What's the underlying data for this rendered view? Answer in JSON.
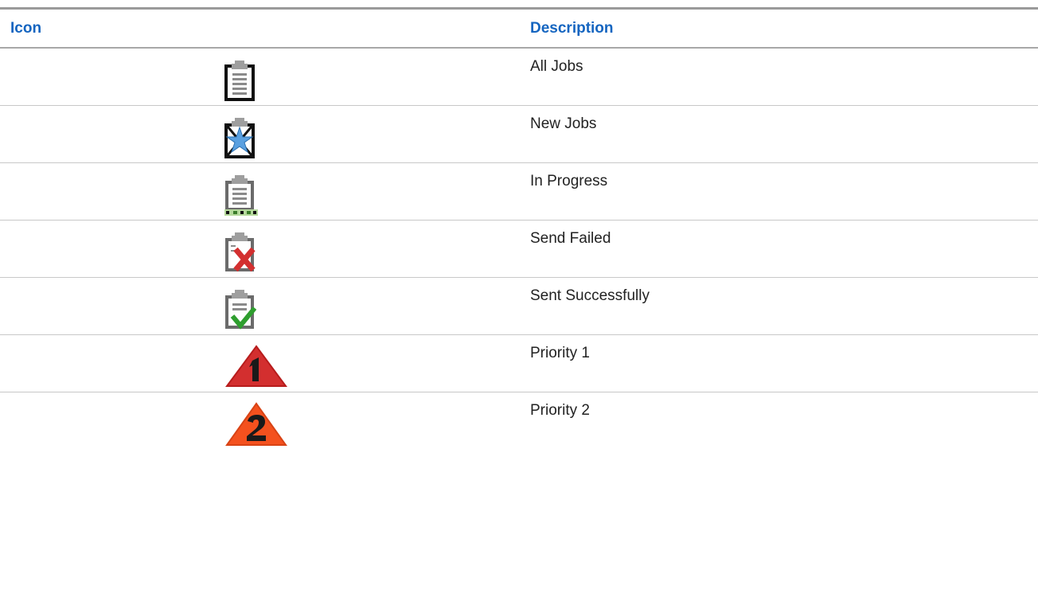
{
  "table": {
    "headers": {
      "icon": "Icon",
      "description": "Description"
    },
    "rows": [
      {
        "icon": "all-jobs-icon",
        "description": "All Jobs"
      },
      {
        "icon": "new-jobs-icon",
        "description": "New Jobs"
      },
      {
        "icon": "in-progress-icon",
        "description": "In Progress"
      },
      {
        "icon": "send-failed-icon",
        "description": "Send Failed"
      },
      {
        "icon": "sent-successfully-icon",
        "description": "Sent Successfully"
      },
      {
        "icon": "priority-1-icon",
        "description": "Priority 1"
      },
      {
        "icon": "priority-2-icon",
        "description": "Priority 2"
      }
    ]
  },
  "colors": {
    "header_text": "#1565c0",
    "priority_1": "#d32f2f",
    "priority_2": "#f4511e",
    "success_check": "#2e9e2e",
    "fail_cross": "#d32f2f",
    "new_star": "#5aa0e0",
    "progress_dots": "#6ab04c"
  }
}
